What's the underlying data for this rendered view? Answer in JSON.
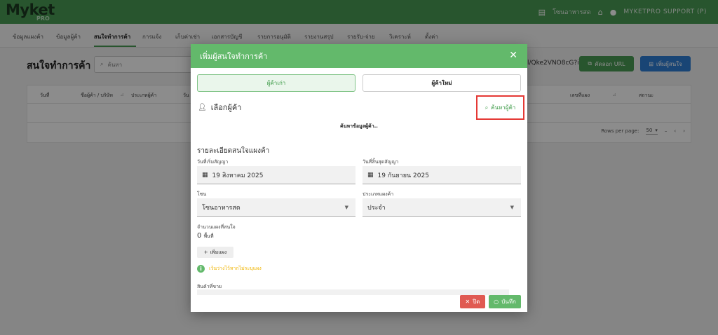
{
  "app": {
    "brand": "Myket",
    "brand_sub": "PRO"
  },
  "topbar": {
    "zone": "โซนอาหารสด",
    "user": "MYKETPRO SUPPORT (P)"
  },
  "nav": {
    "tabs": [
      "ข้อมูลแผงค้า",
      "ข้อมูลผู้ค้า",
      "สนใจทำการค้า",
      "การแจ้ง",
      "เก็บค่าเช่า",
      "เอกสารบัญชี",
      "รายการอนุมัติ",
      "รายงานสรุป",
      "รายรับ-จ่าย",
      "วิเคราะห์",
      "ตั้งค่า"
    ]
  },
  "page": {
    "title": "สนใจทำการค้า",
    "search_placeholder": "ค้นหา",
    "url_fragment": "l/Qke2VNO8cG?i",
    "copy_url_label": "คัดลอก URL",
    "add_label": "เพิ่มผู้สนใจ"
  },
  "table": {
    "headers": [
      "วันที่",
      "ชื่อผู้ค้า / บริษัท",
      "ประเภทผู้ค้า",
      "วัน",
      "เลขที่แผง",
      "สถานะ"
    ],
    "rows_per_page_label": "Rows per page:",
    "rows_per_page": "50",
    "page_range": "–"
  },
  "modal": {
    "title": "เพิ่มผู้สนใจทำการค้า",
    "mode_existing": "ผู้ค้าเก่า",
    "mode_new": "ผู้ค้าใหม่",
    "select_title": "เลือกผู้ค้า",
    "search_customer": "ค้นหาผู้ค้า",
    "hint": "ค้นหาข้อมูลผู้ค้า..",
    "detail_title": "รายละเอียดสนใจแผงค้า",
    "start_label": "วันที่เริ่มสัญญา",
    "start_value": "19 สิงหาคม 2025",
    "end_label": "วันที่สิ้นสุดสัญญา",
    "end_value": "19 กันยายน 2025",
    "zone_label": "โซน",
    "zone_value": "โซนอาหารสด",
    "type_label": "ประเภทแผงค้า",
    "type_value": "ประจำ",
    "count_label": "จำนวนแผงที่สนใจ",
    "count_value": "0",
    "count_unit": "พื้นที่",
    "add_stall_label": "เพิ่มแผง",
    "info_text": "เว้นว่างไว้หากไม่ระบุแผง",
    "products_label": "สินค้าที่ขาย",
    "close_label": "ปิด",
    "save_label": "บันทึก"
  }
}
